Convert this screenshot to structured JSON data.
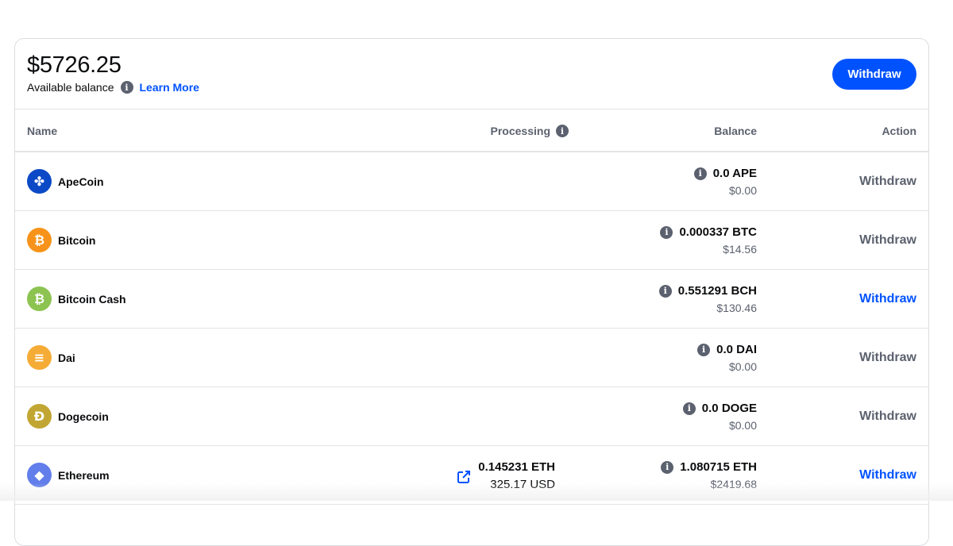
{
  "header": {
    "balance": "$5726.25",
    "balance_label": "Available balance",
    "learn_more": "Learn More",
    "withdraw_label": "Withdraw"
  },
  "table": {
    "columns": {
      "name": "Name",
      "processing": "Processing",
      "balance": "Balance",
      "action": "Action"
    },
    "rows": [
      {
        "name": "ApeCoin",
        "icon": "apecoin-icon",
        "color": "#0b49c6",
        "balance": "0.0 APE",
        "usd": "$0.00",
        "action": "Withdraw",
        "enabled": false
      },
      {
        "name": "Bitcoin",
        "icon": "bitcoin-icon",
        "color": "#f7931a",
        "balance": "0.000337 BTC",
        "usd": "$14.56",
        "action": "Withdraw",
        "enabled": false
      },
      {
        "name": "Bitcoin Cash",
        "icon": "bitcoin-cash-icon",
        "color": "#8dc351",
        "balance": "0.551291 BCH",
        "usd": "$130.46",
        "action": "Withdraw",
        "enabled": true
      },
      {
        "name": "Dai",
        "icon": "dai-icon",
        "color": "#f5ac37",
        "balance": "0.0 DAI",
        "usd": "$0.00",
        "action": "Withdraw",
        "enabled": false
      },
      {
        "name": "Dogecoin",
        "icon": "dogecoin-icon",
        "color": "#c2a633",
        "balance": "0.0 DOGE",
        "usd": "$0.00",
        "action": "Withdraw",
        "enabled": false
      },
      {
        "name": "Ethereum",
        "icon": "ethereum-icon",
        "color": "#627eea",
        "balance": "1.080715 ETH",
        "usd": "$2419.68",
        "action": "Withdraw",
        "enabled": true,
        "processing": "0.145231 ETH",
        "processing_usd": "325.17 USD"
      }
    ]
  },
  "colors": {
    "accent": "#0052ff",
    "muted": "#5b616e"
  }
}
